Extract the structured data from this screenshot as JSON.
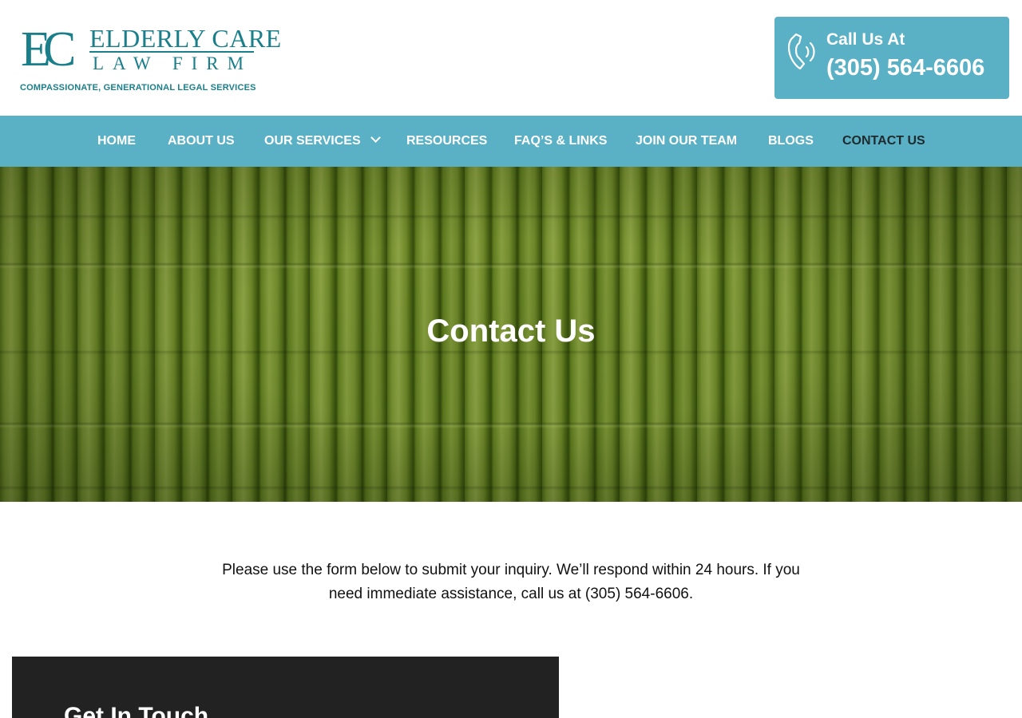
{
  "header": {
    "logo": {
      "monogram": "EC",
      "line1": "ELDERLY CARE",
      "line2": "LAW FIRM",
      "tagline": "COMPASSIONATE, GENERATIONAL LEGAL SERVICES"
    },
    "call": {
      "label": "Call Us At",
      "number": "(305) 564-6606"
    }
  },
  "nav": {
    "items": [
      {
        "label": "HOME"
      },
      {
        "label": "ABOUT US"
      },
      {
        "label": "OUR SERVICES"
      },
      {
        "label": "RESOURCES"
      },
      {
        "label": "FAQ’S & LINKS"
      },
      {
        "label": "JOIN OUR TEAM"
      },
      {
        "label": "BLOGS"
      },
      {
        "label": "CONTACT US"
      }
    ],
    "active": "CONTACT US"
  },
  "hero": {
    "title": "Contact Us"
  },
  "intro": {
    "line1": "Please use the form below to submit your inquiry. We’ll respond within 24 hours. If you",
    "line2": "need immediate assistance, call us at  (305) 564-6606."
  },
  "card": {
    "title": "Get In Touch"
  },
  "colors": {
    "brand_teal": "#1a7f8a",
    "nav_bg": "#5ab0c4",
    "card_bg": "#222222",
    "active_nav": "#1f2a2e"
  },
  "icons": {
    "phone": "phone-icon",
    "dropdown": "chevron-down-icon"
  }
}
